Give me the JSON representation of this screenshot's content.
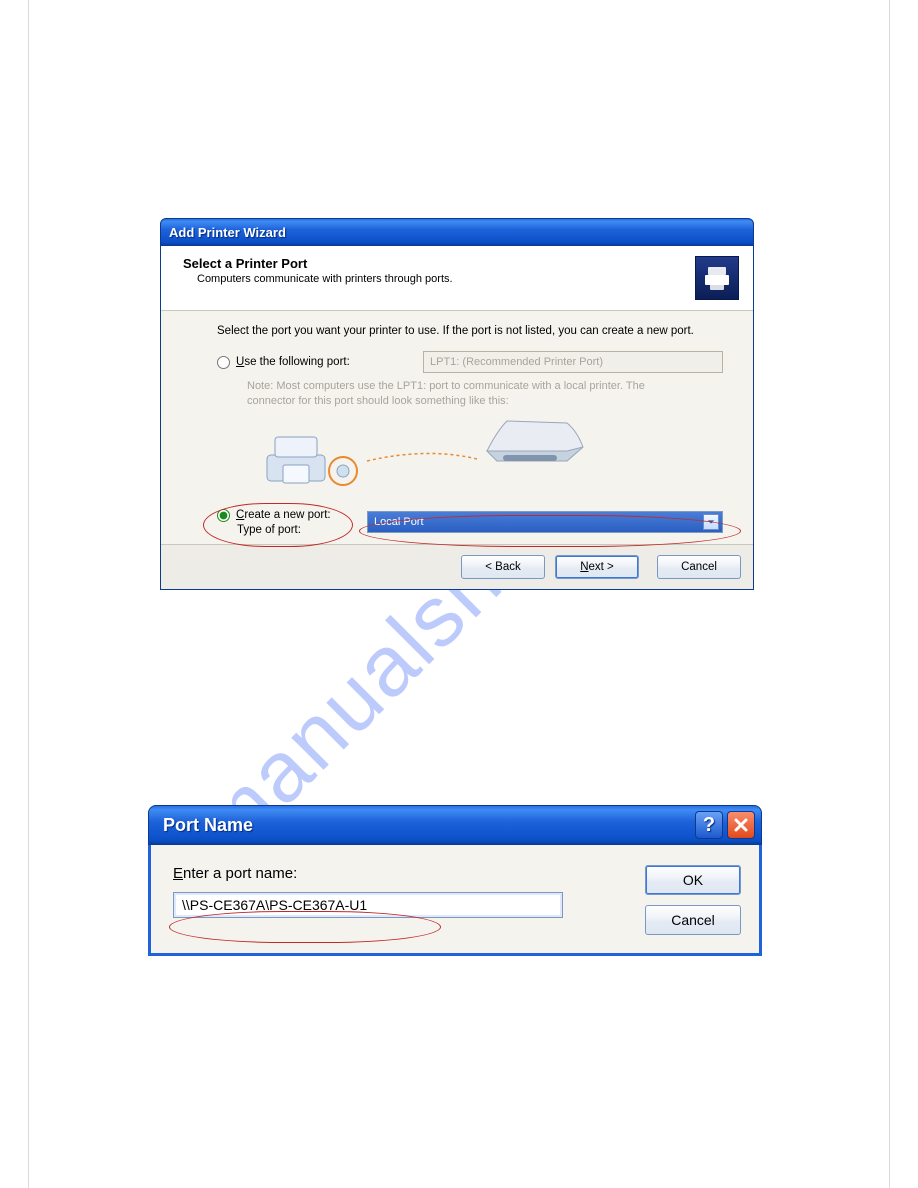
{
  "watermark": "manualshive.com",
  "wizard": {
    "titlebar": "Add Printer Wizard",
    "heading": "Select a Printer Port",
    "subtitle": "Computers communicate with printers through ports.",
    "instruction": "Select the port you want your printer to use. If the port is not listed, you can create a new port.",
    "radio_use": "Use the following port:",
    "disabled_port_value": "LPT1: (Recommended Printer Port)",
    "note_line1": "Note: Most computers use the LPT1: port to communicate with a local printer. The",
    "note_line2": "connector for this port should look something like this:",
    "radio_create": "Create a new port:",
    "type_label": "Type of port:",
    "selected_port_type": "Local Port",
    "back_btn": "< Back",
    "next_btn": "Next >",
    "cancel_btn": "Cancel"
  },
  "portdlg": {
    "title": "Port Name",
    "prompt": "Enter a port name:",
    "value": "\\\\PS-CE367A\\PS-CE367A-U1",
    "ok": "OK",
    "cancel": "Cancel",
    "help_glyph": "?"
  }
}
